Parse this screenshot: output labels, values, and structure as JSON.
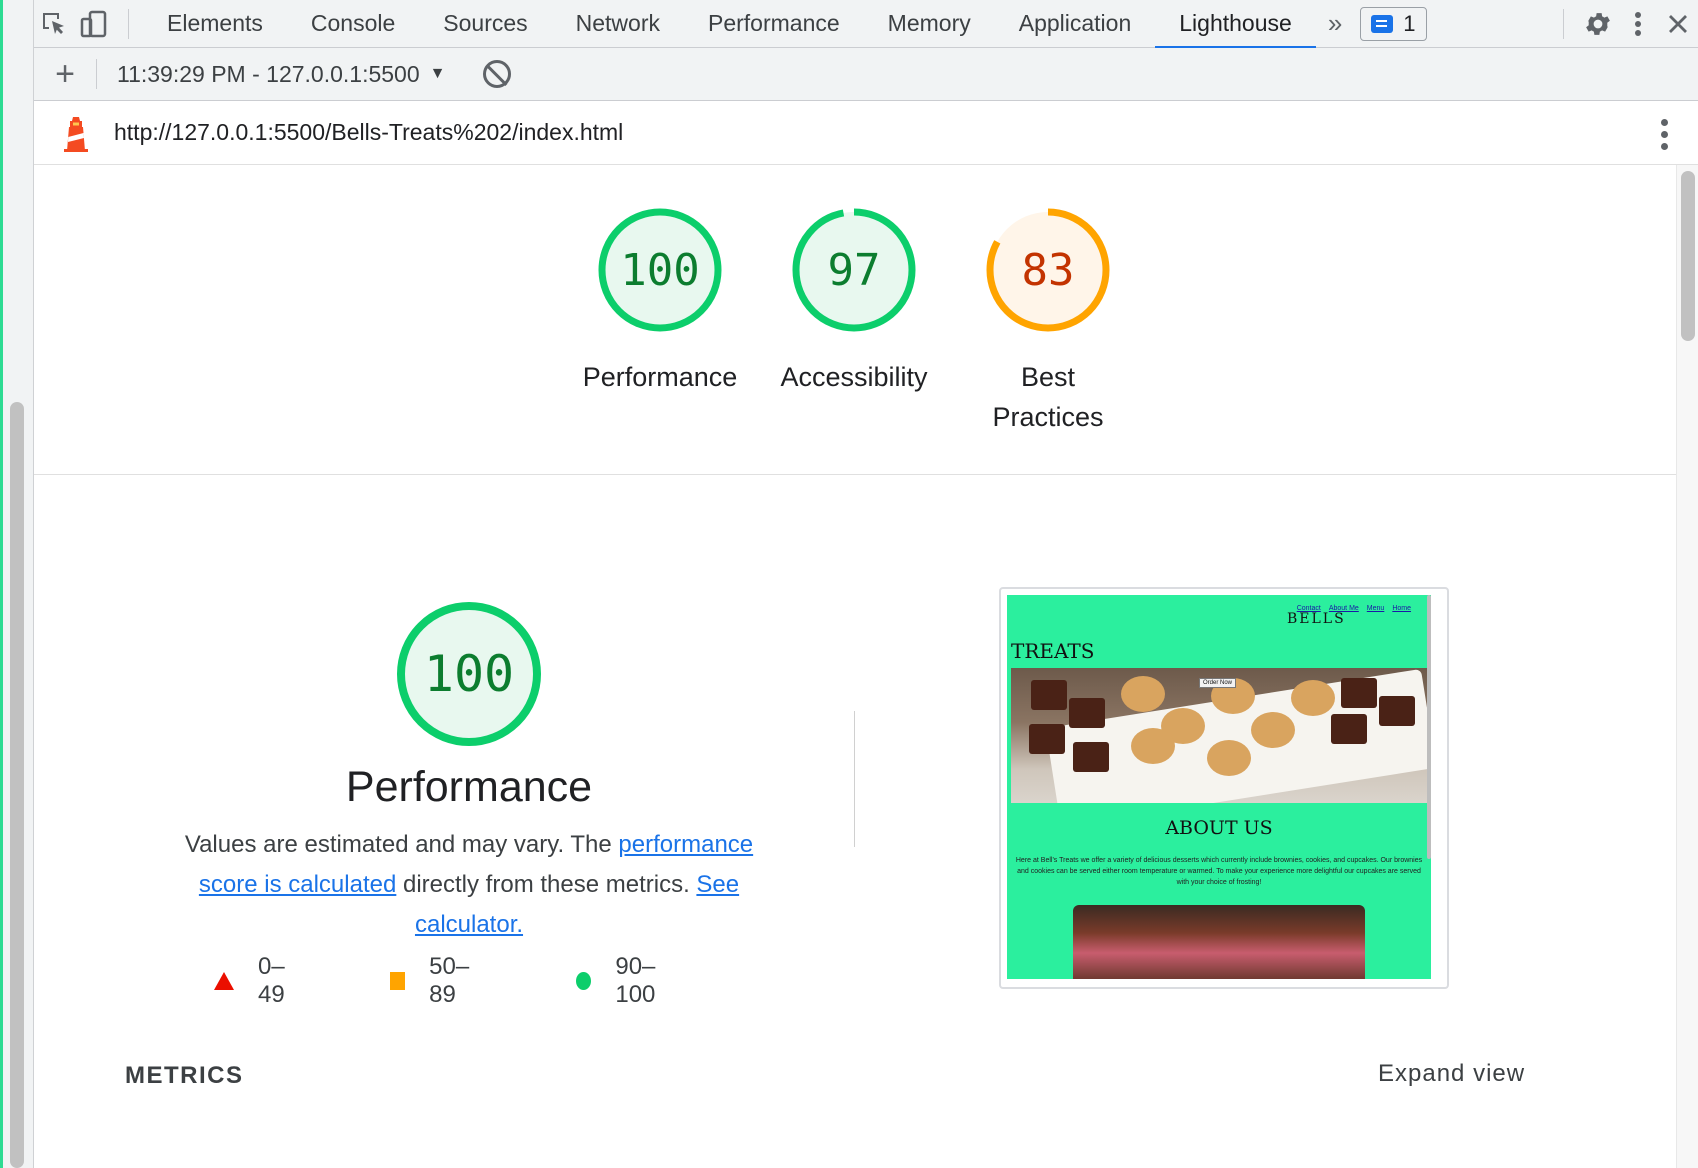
{
  "devtools": {
    "tabs": [
      {
        "label": "Elements"
      },
      {
        "label": "Console"
      },
      {
        "label": "Sources"
      },
      {
        "label": "Network"
      },
      {
        "label": "Performance"
      },
      {
        "label": "Memory"
      },
      {
        "label": "Application"
      },
      {
        "label": "Lighthouse"
      }
    ],
    "active_tab": "Lighthouse",
    "more_tabs_icon": "»",
    "issues_count": "1"
  },
  "toolbar": {
    "new_report_icon": "+",
    "report_select": "11:39:29 PM - 127.0.0.1:5500",
    "caret": "▼"
  },
  "urlbar": {
    "url": "http://127.0.0.1:5500/Bells-Treats%202/index.html"
  },
  "summary_gauges": [
    {
      "score": "100",
      "label": "Performance",
      "color": "#0c7d2f",
      "ring": "#0cce6b",
      "fill": "#e8f8ef",
      "fraction": 1.0
    },
    {
      "score": "97",
      "label": "Accessibility",
      "color": "#0c7d2f",
      "ring": "#0cce6b",
      "fill": "#e8f8ef",
      "fraction": 0.97
    },
    {
      "score": "83",
      "label": "Best Practices",
      "color": "#c33300",
      "ring": "#ffa400",
      "fill": "#fff5e9",
      "fraction": 0.83
    }
  ],
  "performance": {
    "score": "100",
    "title": "Performance",
    "desc_prefix": "Values are estimated and may vary. The ",
    "link1": "performance score is calculated",
    "desc_middle": " directly from these metrics. ",
    "link2": "See calculator.",
    "legend": [
      {
        "shape": "triangle",
        "range": "0–49",
        "color": "#eb0f00"
      },
      {
        "shape": "square",
        "range": "50–89",
        "color": "#ffa400"
      },
      {
        "shape": "circle",
        "range": "90–100",
        "color": "#0cce6b"
      }
    ]
  },
  "screenshot": {
    "nav_links": [
      "Contact",
      "About Me",
      "Menu",
      "Home"
    ],
    "brand_top": "BELLS",
    "brand": "TREATS",
    "order_button": "Order Now",
    "about_heading": "ABOUT US",
    "about_text": "Here at Bell's Treats we offer a variety of delicious desserts which currently include brownies, cookies, and cupcakes. Our brownies and cookies can be served either room temperature or warmed. To make your experience more delightful our cupcakes are served with your choice of frosting!"
  },
  "metrics": {
    "label": "METRICS",
    "expand": "Expand view"
  }
}
